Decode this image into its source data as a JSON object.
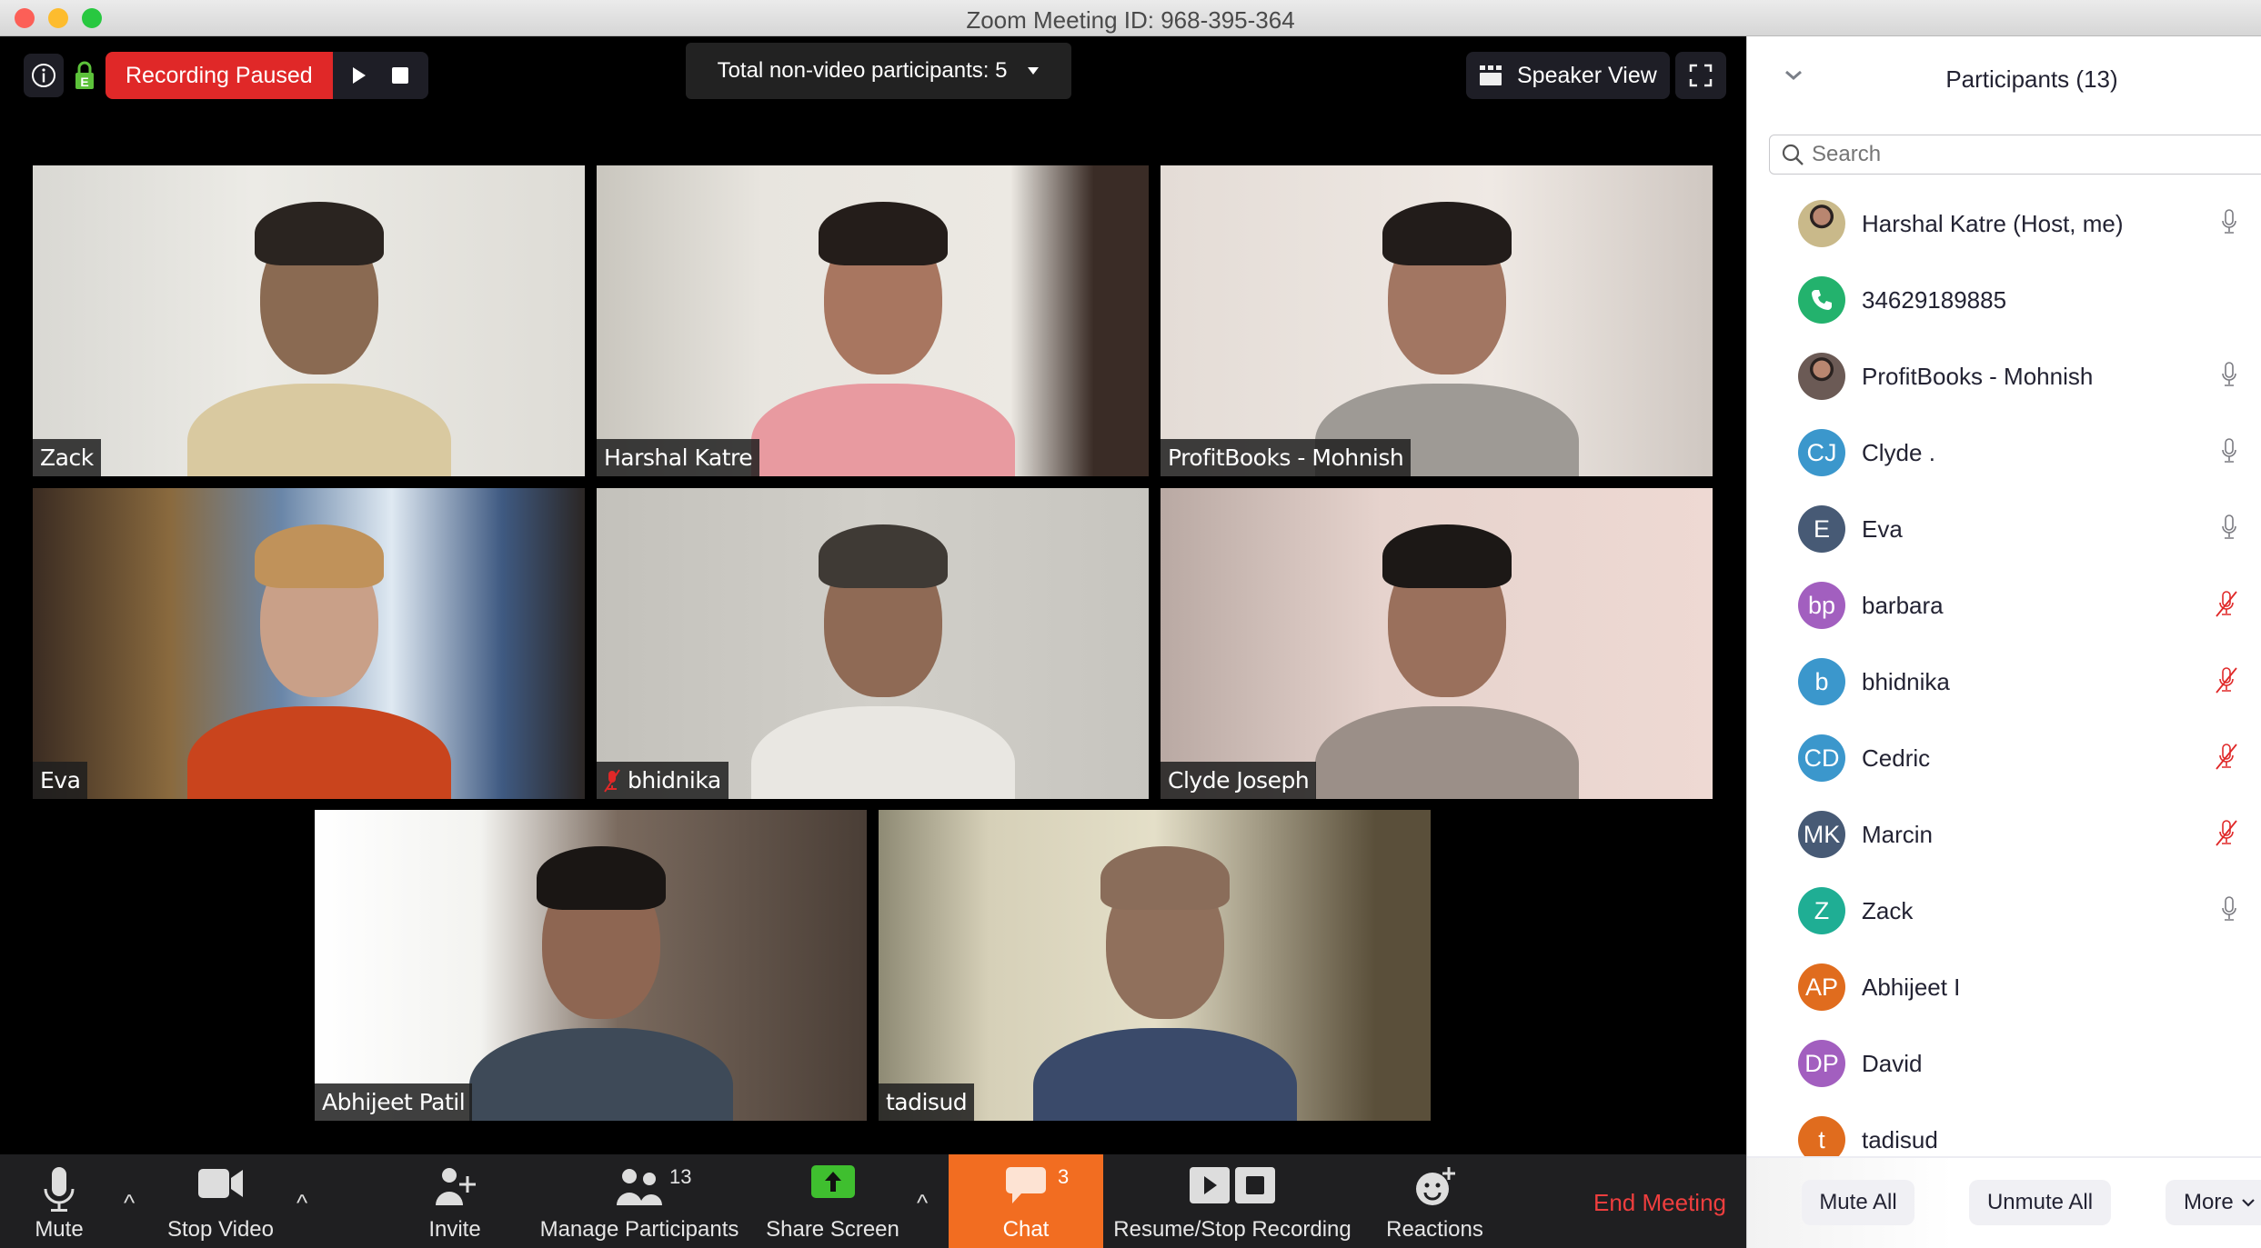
{
  "window": {
    "title": "Zoom Meeting ID: 968-395-364",
    "traffic_lights": {
      "close": "#fc5f57",
      "minimize": "#fdbc2e",
      "maximize": "#28c840"
    }
  },
  "top_bar": {
    "info_icon": "info-icon",
    "encryption_icon": "lock-e-icon",
    "recording_status": "Recording Paused",
    "recording_color": "#e02828",
    "resume_icon": "play-icon",
    "stop_icon": "stop-icon",
    "non_video_label": "Total non-video participants: 5",
    "speaker_view_label": "Speaker View",
    "fullscreen_icon": "fullscreen-icon"
  },
  "video_tiles": [
    {
      "name": "Zack",
      "muted": false
    },
    {
      "name": "Harshal Katre",
      "muted": false
    },
    {
      "name": "ProfitBooks - Mohnish",
      "muted": false
    },
    {
      "name": "Eva",
      "muted": false
    },
    {
      "name": "bhidnika",
      "muted": true
    },
    {
      "name": "Clyde Joseph",
      "muted": false
    },
    {
      "name": "Abhijeet Patil",
      "muted": false
    },
    {
      "name": "tadisud",
      "muted": false
    }
  ],
  "toolbar": {
    "mute": "Mute",
    "stop_video": "Stop Video",
    "invite": "Invite",
    "manage_participants": "Manage Participants",
    "participant_count": "13",
    "share_screen": "Share Screen",
    "chat": "Chat",
    "chat_count": "3",
    "recording": "Resume/Stop Recording",
    "reactions": "Reactions",
    "end_meeting": "End Meeting",
    "accent_chat": "#f26d21",
    "share_color": "#3fbf2f",
    "end_color": "#ef3e3e"
  },
  "panel": {
    "title": "Participants (13)",
    "search_placeholder": "Search",
    "participants": [
      {
        "name": "Harshal Katre (Host, me)",
        "initials": "",
        "avatar": "photo",
        "color": "#c9b98a",
        "mic": "on"
      },
      {
        "name": "34629189885",
        "initials": "",
        "avatar": "phone",
        "color": "#23b26d",
        "mic": "none"
      },
      {
        "name": "ProfitBooks - Mohnish",
        "initials": "",
        "avatar": "photo",
        "color": "#6b5a55",
        "mic": "on"
      },
      {
        "name": "Clyde .",
        "initials": "CJ",
        "avatar": "initials",
        "color": "#3b97cc",
        "mic": "on"
      },
      {
        "name": "Eva",
        "initials": "E",
        "avatar": "initials",
        "color": "#475a75",
        "mic": "on"
      },
      {
        "name": "barbara",
        "initials": "bp",
        "avatar": "initials",
        "color": "#a25fbf",
        "mic": "muted"
      },
      {
        "name": "bhidnika",
        "initials": "b",
        "avatar": "initials",
        "color": "#3b97cc",
        "mic": "muted"
      },
      {
        "name": "Cedric",
        "initials": "CD",
        "avatar": "initials",
        "color": "#3b97cc",
        "mic": "muted"
      },
      {
        "name": "Marcin",
        "initials": "MK",
        "avatar": "initials",
        "color": "#475a75",
        "mic": "muted"
      },
      {
        "name": "Zack",
        "initials": "Z",
        "avatar": "initials",
        "color": "#1fae94",
        "mic": "on"
      },
      {
        "name": "Abhijeet I",
        "initials": "AP",
        "avatar": "initials",
        "color": "#e06c1e",
        "mic": "none"
      },
      {
        "name": "David",
        "initials": "DP",
        "avatar": "initials",
        "color": "#a25fbf",
        "mic": "none"
      },
      {
        "name": "tadisud",
        "initials": "t",
        "avatar": "initials",
        "color": "#e06c1e",
        "mic": "none"
      }
    ],
    "mute_all": "Mute All",
    "unmute_all": "Unmute All",
    "more": "More"
  }
}
